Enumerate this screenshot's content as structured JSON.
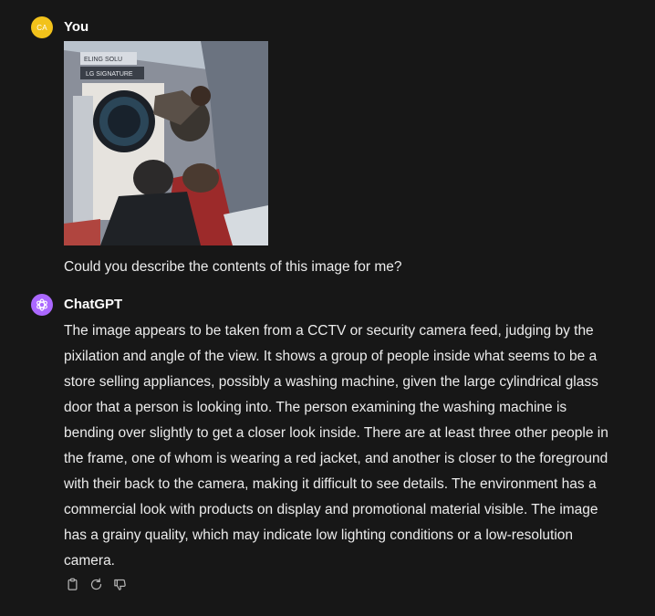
{
  "conversation": {
    "user_message": {
      "avatar_initials": "CA",
      "author": "You",
      "text": "Could you describe the contents of this image for me?",
      "image_sign_top": "ELING SOLU",
      "image_sign_bottom": "LG SIGNATURE"
    },
    "assistant_message": {
      "author": "ChatGPT",
      "lines": [
        "The image appears to be taken from a CCTV or security camera feed, judging by the",
        "pixilation and angle of the view. It shows a group of people inside what seems to be a",
        "store selling appliances, possibly a washing machine, given the large cylindrical glass",
        "door that a person is looking into. The person examining the washing machine is",
        "bending over slightly to get a closer look inside. There are at least three other people in",
        "the frame, one of whom is wearing a red jacket, and another is closer to the foreground",
        "with their back to the camera, making it difficult to see details. The environment has a",
        "commercial look with products on display and promotional material visible. The image",
        "has a grainy quality, which may indicate low lighting conditions or a low-resolution",
        "camera."
      ]
    },
    "actions": {
      "copy_icon": "clipboard-icon",
      "regenerate_icon": "refresh-icon",
      "dislike_icon": "thumbs-down-icon"
    }
  }
}
